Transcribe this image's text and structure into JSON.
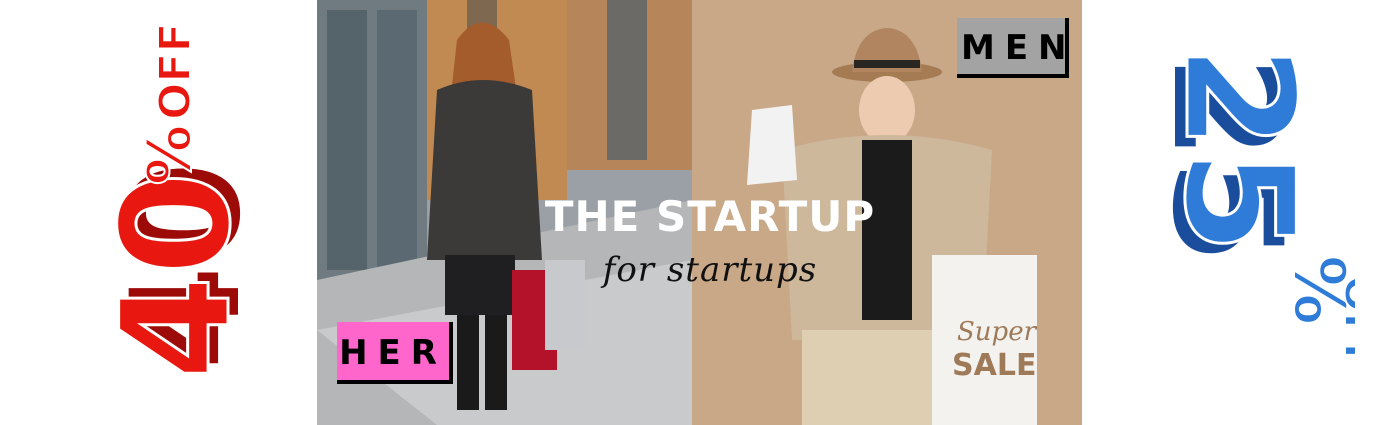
{
  "left_offer": {
    "percent": "40",
    "sign": "%",
    "suffix": "OFF",
    "color": "#e8170f",
    "shadow_color": "#9d0b08"
  },
  "right_offer": {
    "percent": "25",
    "sign": "%",
    "suffix": "OFF",
    "color": "#2e7bd8",
    "shadow_color": "#1a4e9c"
  },
  "headline": {
    "title": "THE STARTUP",
    "tagline": "for startups"
  },
  "tags": {
    "men": "MEN",
    "her": "HER",
    "men_bg": "#a3a3a3",
    "her_bg": "#ff66cc"
  },
  "bag_print": {
    "top": "Super",
    "bottom": "SALE"
  }
}
